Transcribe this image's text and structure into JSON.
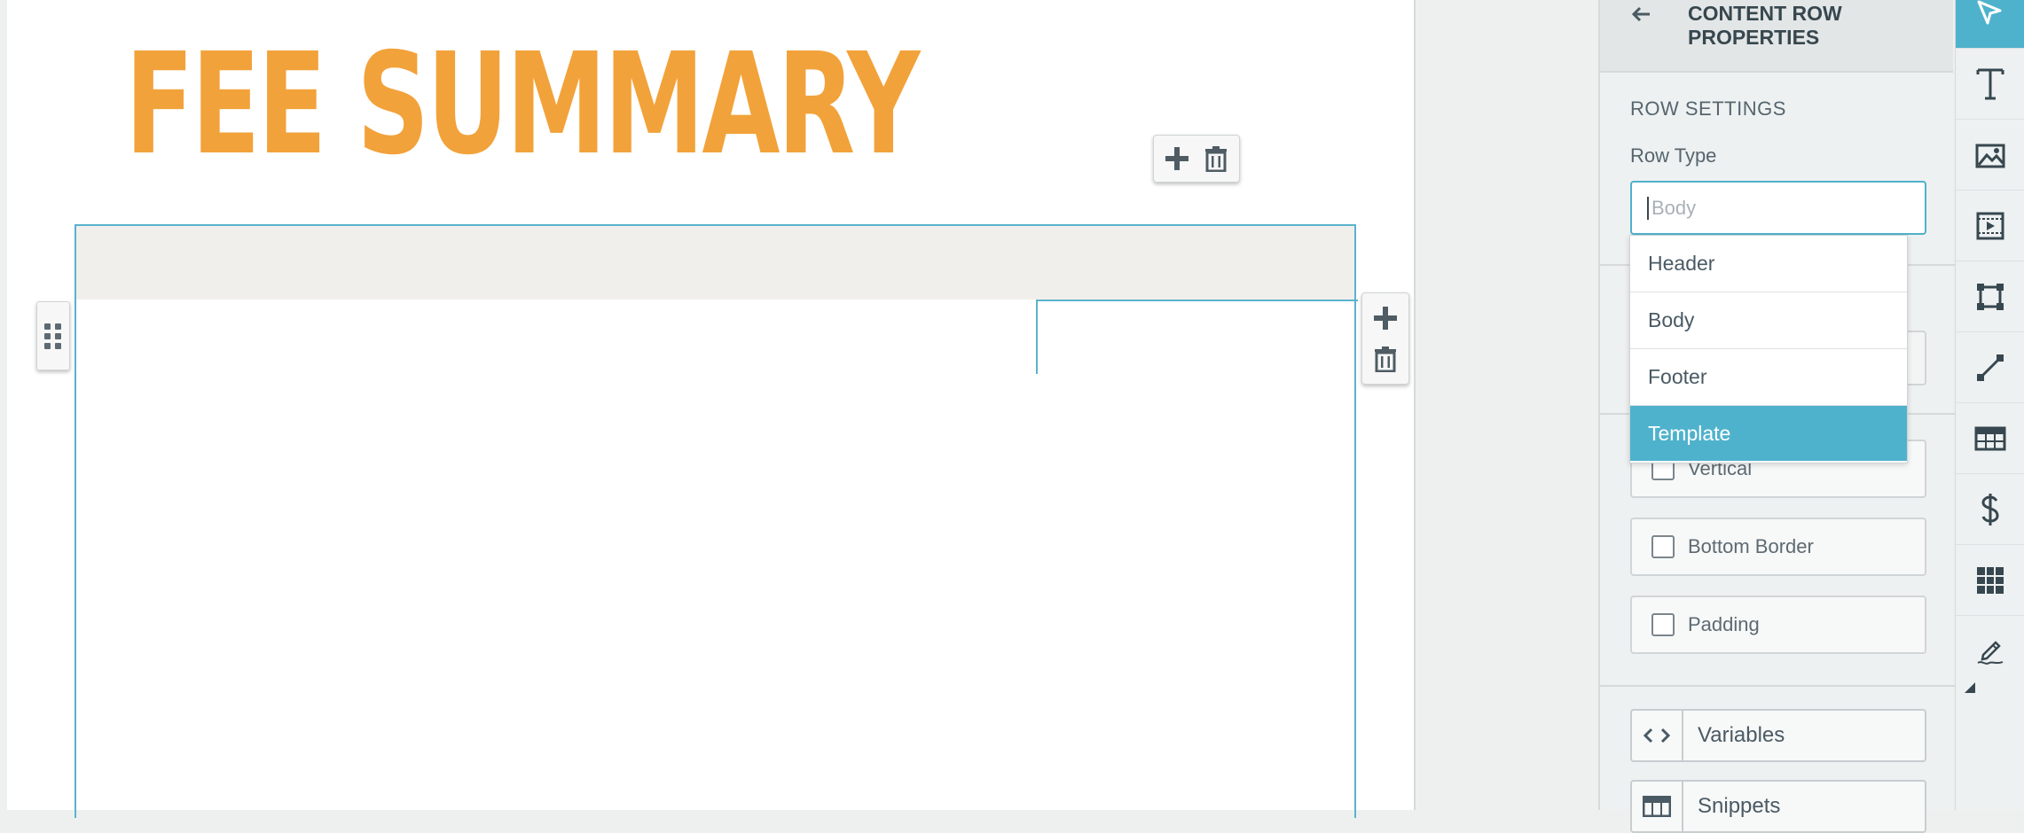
{
  "document": {
    "title": "FEE SUMMARY",
    "title_color": "#f2a23a",
    "row_outline_color": "#5ab3cd",
    "header_band_color": "#f1efec"
  },
  "canvas_toolbars": {
    "title_toolbar_icons": [
      "plus-icon",
      "trash-icon"
    ],
    "row_toolbar_icons": [
      "plus-icon",
      "trash-icon"
    ],
    "drag_handle_icon": "grip-dots-icon"
  },
  "panel": {
    "back_icon": "arrow-left-icon",
    "title": "CONTENT ROW PROPERTIES",
    "section": "ROW SETTINGS",
    "row_type_label": "Row Type",
    "row_type_placeholder": "Body",
    "row_type_value": "",
    "dropdown_options": [
      {
        "label": "Header",
        "selected": false
      },
      {
        "label": "Body",
        "selected": false
      },
      {
        "label": "Footer",
        "selected": false
      },
      {
        "label": "Template",
        "selected": true
      }
    ],
    "checkboxes": [
      {
        "label": "Vertical",
        "checked": false
      },
      {
        "label": "Bottom Border",
        "checked": false
      },
      {
        "label": "Padding",
        "checked": false
      }
    ],
    "tools": [
      {
        "label": "Variables",
        "icon": "code-brackets-icon"
      },
      {
        "label": "Snippets",
        "icon": "snippet-table-icon"
      }
    ],
    "accent_color": "#4fb2cc"
  },
  "tool_rail": {
    "items": [
      {
        "icon": "pointer-icon",
        "active": true
      },
      {
        "icon": "text-icon",
        "active": false
      },
      {
        "icon": "image-icon",
        "active": false
      },
      {
        "icon": "video-icon",
        "active": false
      },
      {
        "icon": "shape-icon",
        "active": false
      },
      {
        "icon": "line-icon",
        "active": false
      },
      {
        "icon": "table-icon",
        "active": false
      },
      {
        "icon": "dollar-icon",
        "active": false
      },
      {
        "icon": "grid-icon",
        "active": false
      },
      {
        "icon": "signature-icon",
        "active": false
      }
    ]
  }
}
